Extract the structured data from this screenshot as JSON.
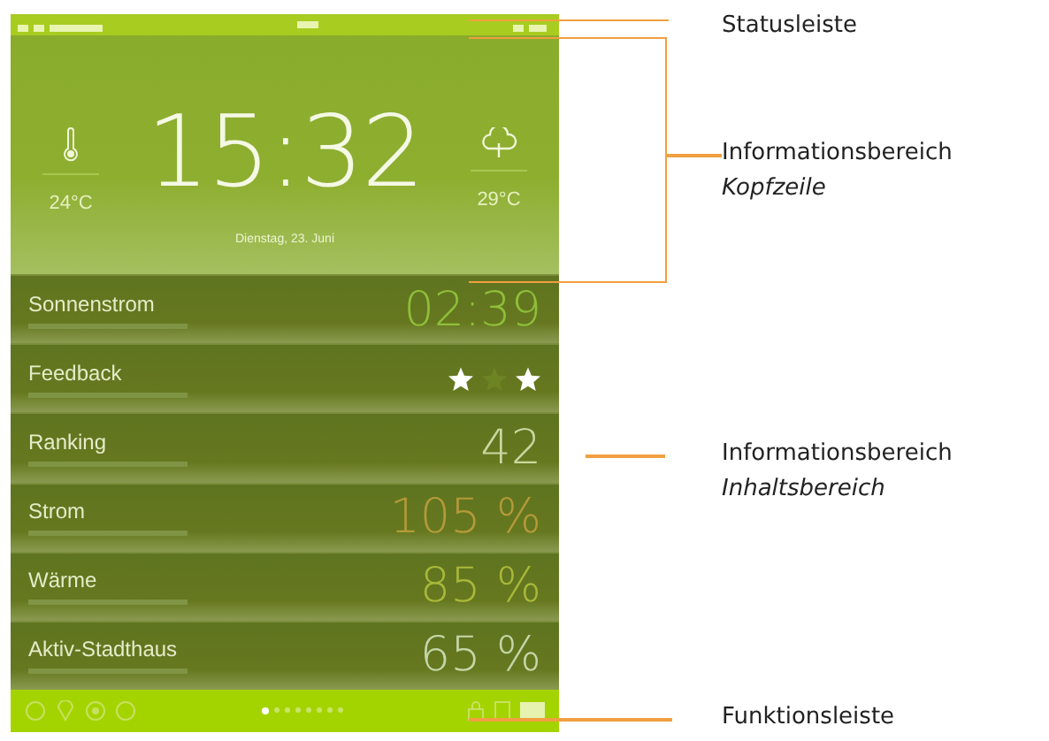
{
  "header": {
    "time": "15:32",
    "date": "Dienstag, 23. Juni",
    "indoor_temperature": "24°C",
    "outdoor_temperature": "29°C"
  },
  "rows": [
    {
      "kind": "value",
      "title": "Sonnenstrom",
      "value": "02:39",
      "color": "#8fbf3a"
    },
    {
      "kind": "stars",
      "title": "Feedback",
      "stars_row": [
        {
          "filled": true
        },
        {
          "filled": false
        },
        {
          "filled": true
        }
      ]
    },
    {
      "kind": "value",
      "title": "Ranking",
      "value": "42",
      "color": "#c8d8a0"
    },
    {
      "kind": "value",
      "title": "Strom",
      "value": "105 %",
      "color": "#b59a3a"
    },
    {
      "kind": "value",
      "title": "Wärme",
      "value": "85 %",
      "color": "#a9b83a"
    },
    {
      "kind": "value",
      "title": "Aktiv-Stadthaus",
      "value": "65 %",
      "color": "#c5d6a8"
    }
  ],
  "footer": {
    "pages": [
      {
        "selected": true
      },
      {
        "selected": false
      },
      {
        "selected": false
      },
      {
        "selected": false
      },
      {
        "selected": false
      },
      {
        "selected": false
      },
      {
        "selected": false
      },
      {
        "selected": false
      }
    ]
  },
  "callouts": [
    {
      "kind": "status",
      "label": "Statusleiste"
    },
    {
      "kind": "header",
      "label": "Informationsbereich",
      "sublabel": "Kopfzeile"
    },
    {
      "kind": "content",
      "label": "Informationsbereich",
      "sublabel": "Inhaltsbereich"
    },
    {
      "kind": "footer",
      "label": "Funktionsleiste"
    }
  ]
}
